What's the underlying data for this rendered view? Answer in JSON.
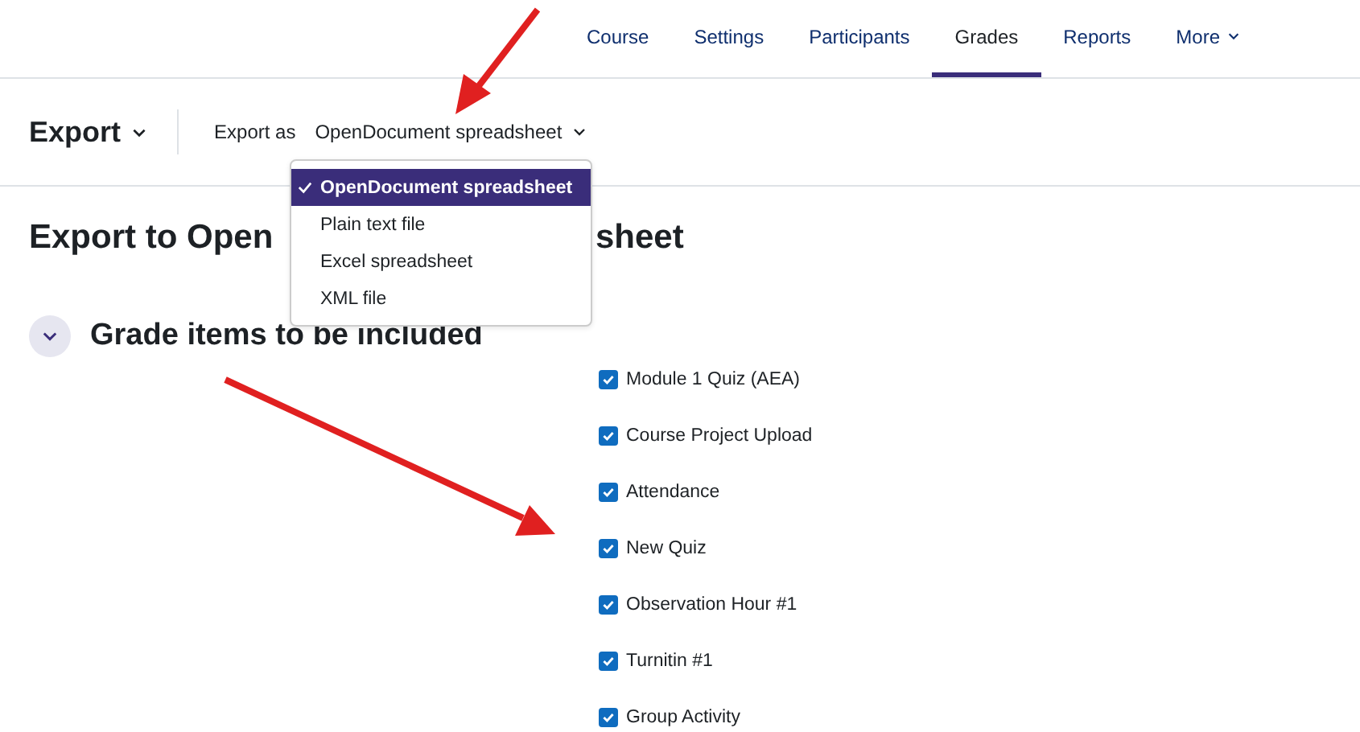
{
  "nav": {
    "items": [
      {
        "label": "Course",
        "selected": false
      },
      {
        "label": "Settings",
        "selected": false
      },
      {
        "label": "Participants",
        "selected": false
      },
      {
        "label": "Grades",
        "selected": true
      },
      {
        "label": "Reports",
        "selected": false
      },
      {
        "label": "More",
        "selected": false,
        "kind": "menu"
      }
    ]
  },
  "page_menu": {
    "label": "Export"
  },
  "export_as": {
    "label": "Export as",
    "value": "OpenDocument spreadsheet",
    "expanded": true,
    "options": [
      {
        "label": "OpenDocument spreadsheet",
        "selected": true
      },
      {
        "label": "Plain text file",
        "selected": false
      },
      {
        "label": "Excel spreadsheet",
        "selected": false
      },
      {
        "label": "XML file",
        "selected": false
      }
    ]
  },
  "heading": [
    "Export to Open",
    "sheet"
  ],
  "section": {
    "title": "Grade items to be included",
    "expanded": true,
    "items": [
      {
        "label": "Module 1 Quiz (AEA)",
        "checked": true
      },
      {
        "label": "Course Project Upload",
        "checked": true
      },
      {
        "label": "Attendance",
        "checked": true
      },
      {
        "label": "New Quiz",
        "checked": true
      },
      {
        "label": "Observation Hour #1",
        "checked": true
      },
      {
        "label": "Turnitin #1",
        "checked": true
      },
      {
        "label": "Group Activity",
        "checked": true
      }
    ]
  }
}
